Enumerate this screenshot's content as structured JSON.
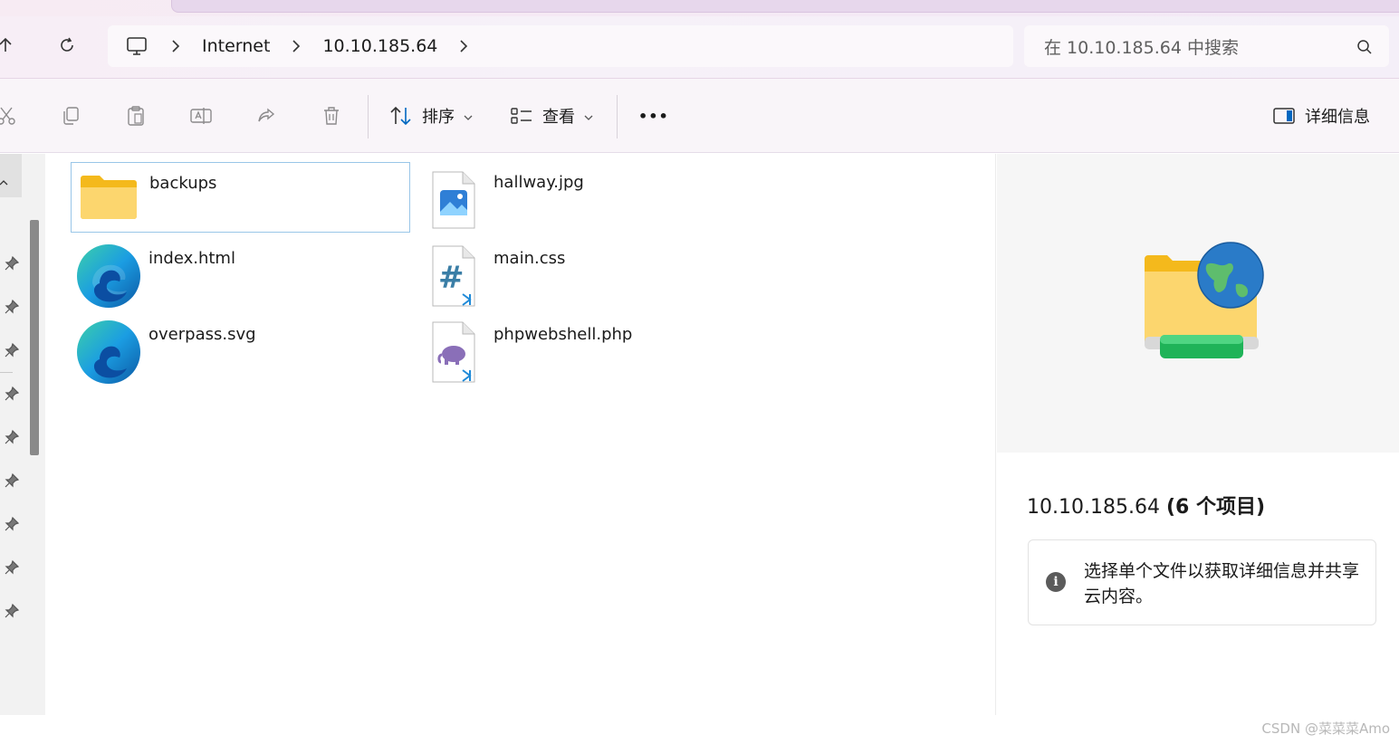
{
  "breadcrumb": {
    "items": [
      "Internet",
      "10.10.185.64"
    ]
  },
  "search": {
    "placeholder": "在 10.10.185.64 中搜索"
  },
  "toolbar": {
    "sort_label": "排序",
    "view_label": "查看",
    "details_label": "详细信息",
    "more_label": "•••"
  },
  "files": [
    {
      "name": "backups",
      "icon": "folder-icon",
      "selected": true
    },
    {
      "name": "hallway.jpg",
      "icon": "image-file-icon",
      "selected": false
    },
    {
      "name": "index.html",
      "icon": "edge-icon",
      "selected": false
    },
    {
      "name": "main.css",
      "icon": "css-file-icon",
      "selected": false
    },
    {
      "name": "overpass.svg",
      "icon": "edge-icon",
      "selected": false
    },
    {
      "name": "phpwebshell.php",
      "icon": "php-file-icon",
      "selected": false
    }
  ],
  "details": {
    "title_host": "10.10.185.64",
    "title_count": "(6 个项目)",
    "info_text": "选择单个文件以获取详细信息并共享云内容。"
  },
  "watermark": "CSDN @菜菜菜Amo",
  "colors": {
    "accent": "#0067c0",
    "selection_border": "#99c6e8",
    "folder_yellow": "#f8c646"
  }
}
